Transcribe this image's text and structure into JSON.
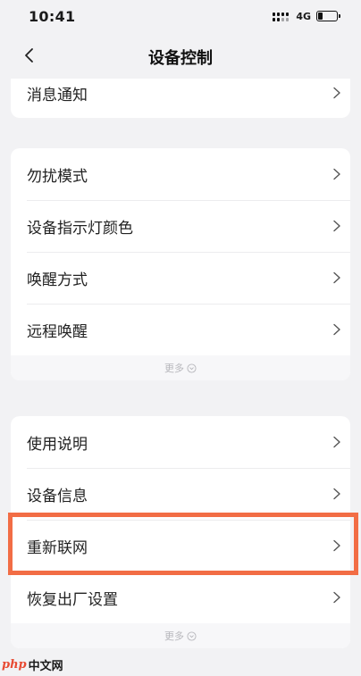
{
  "status_bar": {
    "time": "10:41",
    "network": "4G"
  },
  "nav": {
    "title": "设备控制"
  },
  "groups": [
    {
      "items": [
        {
          "label": "消息通知"
        }
      ]
    },
    {
      "items": [
        {
          "label": "勿扰模式"
        },
        {
          "label": "设备指示灯颜色"
        },
        {
          "label": "唤醒方式"
        },
        {
          "label": "远程唤醒"
        }
      ],
      "more": "更多"
    },
    {
      "items": [
        {
          "label": "使用说明"
        },
        {
          "label": "设备信息"
        },
        {
          "label": "重新联网"
        },
        {
          "label": "恢复出厂设置"
        }
      ],
      "more": "更多"
    }
  ],
  "highlighted_item": "重新联网",
  "watermark": {
    "brand": "php",
    "text": "中文网"
  },
  "colors": {
    "highlight": "#f26d45",
    "background": "#f2f2f4"
  }
}
